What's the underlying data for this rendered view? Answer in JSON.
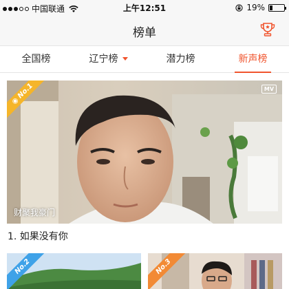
{
  "status_bar": {
    "carrier": "中国联通",
    "time": "上午12:51",
    "battery_percent": "19%",
    "battery_level": 0.19,
    "icons": [
      "signal-dots",
      "wifi-icon",
      "rotation-lock-icon",
      "battery-icon"
    ]
  },
  "nav": {
    "title": "榜单",
    "right_icon": "trophy-icon"
  },
  "tabs": [
    {
      "label": "全国榜",
      "active": false
    },
    {
      "label": "辽宁榜",
      "active": false,
      "has_dropdown": true
    },
    {
      "label": "潜力榜",
      "active": false
    },
    {
      "label": "新声榜",
      "active": true
    }
  ],
  "featured": {
    "badge": "No.1",
    "badge_icon": "camera-icon",
    "mv_label": "MV",
    "overlay_caption": "财聚我豪门",
    "title": "1. 如果没有你"
  },
  "cards": [
    {
      "badge": "No.2"
    },
    {
      "badge": "No.3"
    }
  ],
  "colors": {
    "accent": "#f0542d",
    "badge_1": "#f5b52a",
    "badge_2": "#3fa2e8",
    "badge_3": "#f28a35"
  }
}
